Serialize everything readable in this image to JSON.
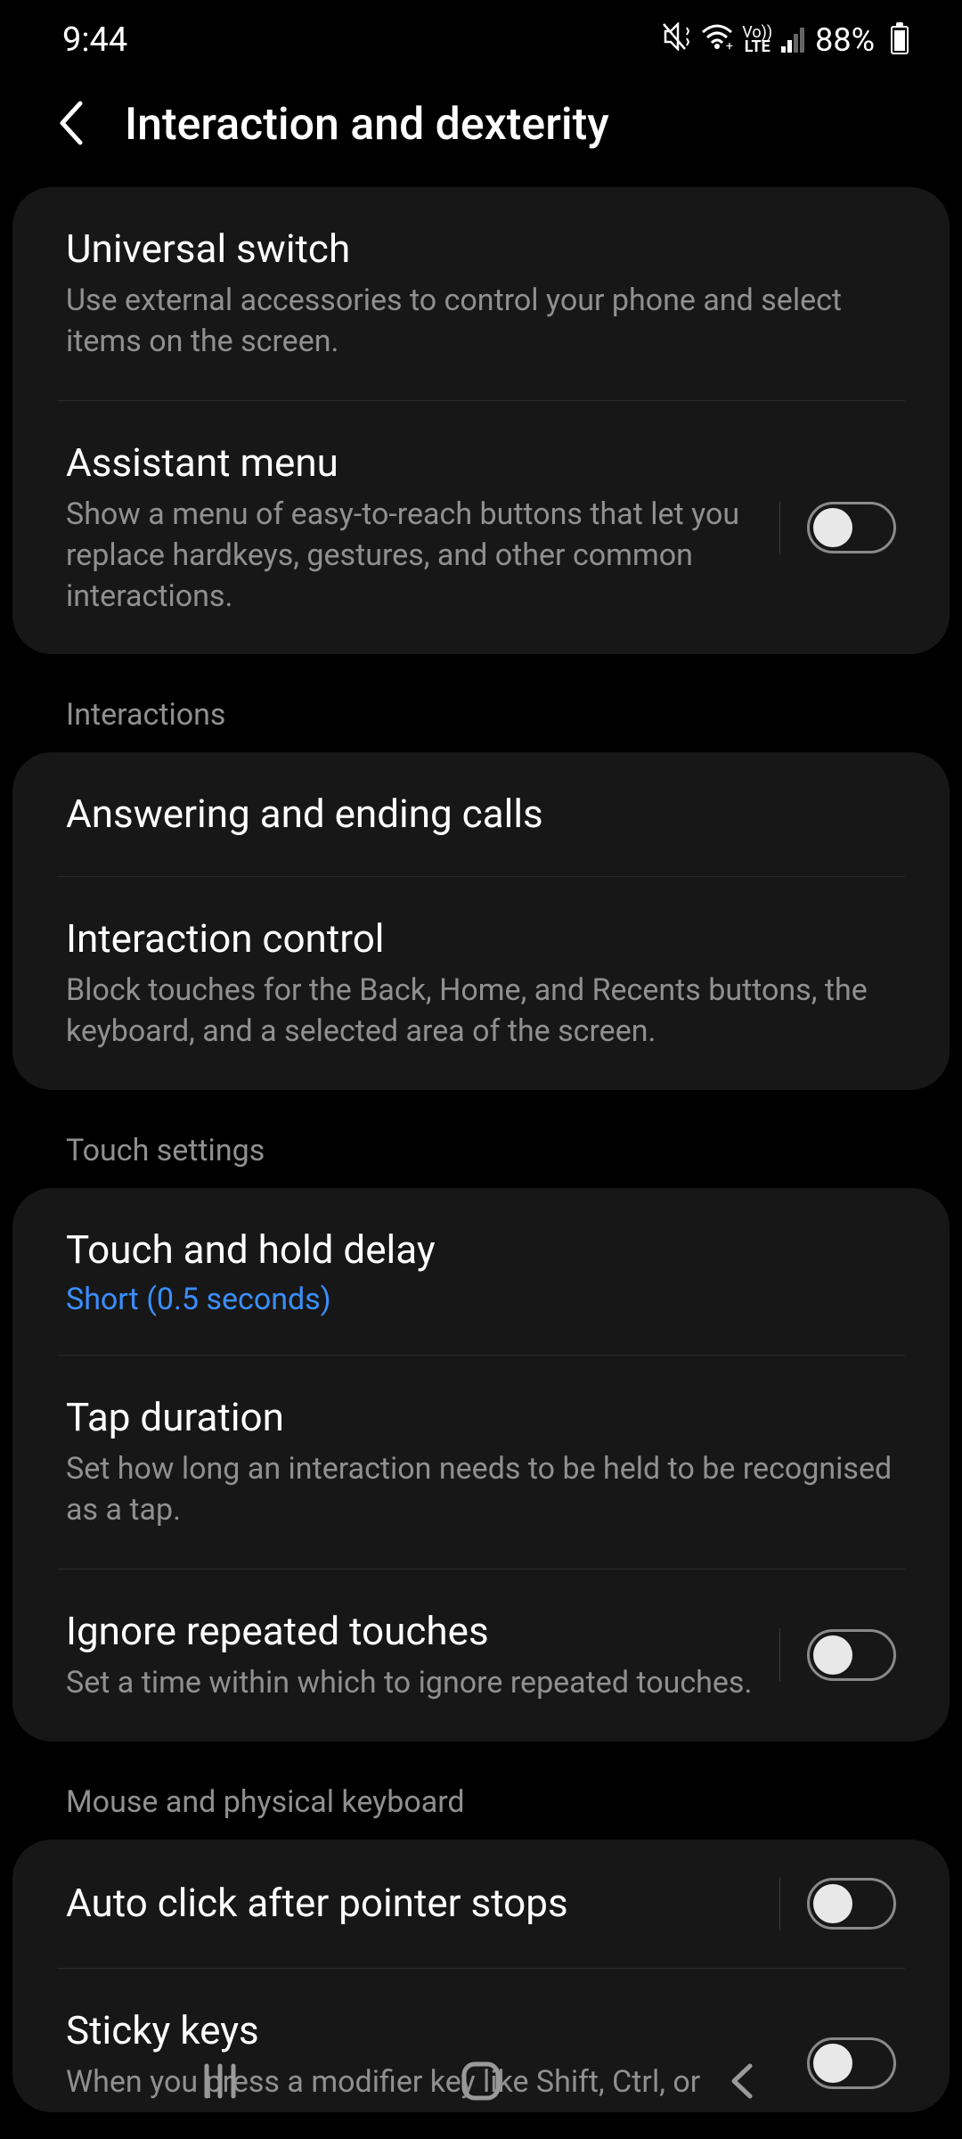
{
  "status": {
    "time": "9:44",
    "battery": "88%",
    "network": "LTE",
    "vo": "Vo))"
  },
  "header": {
    "title": "Interaction and dexterity"
  },
  "group1": {
    "universal_switch": {
      "title": "Universal switch",
      "desc": "Use external accessories to control your phone and select items on the screen."
    },
    "assistant_menu": {
      "title": "Assistant menu",
      "desc": "Show a menu of easy-to-reach buttons that let you replace hardkeys, gestures, and other common interactions."
    }
  },
  "sections": {
    "interactions": "Interactions",
    "touch_settings": "Touch settings",
    "mouse_keyboard": "Mouse and physical keyboard"
  },
  "interactions": {
    "answering_calls": {
      "title": "Answering and ending calls"
    },
    "interaction_control": {
      "title": "Interaction control",
      "desc": "Block touches for the Back, Home, and Recents buttons, the keyboard, and a selected area of the screen."
    }
  },
  "touch": {
    "touch_hold_delay": {
      "title": "Touch and hold delay",
      "value": "Short (0.5 seconds)"
    },
    "tap_duration": {
      "title": "Tap duration",
      "desc": "Set how long an interaction needs to be held to be recognised as a tap."
    },
    "ignore_repeated": {
      "title": "Ignore repeated touches",
      "desc": "Set a time within which to ignore repeated touches."
    }
  },
  "mouse": {
    "auto_click": {
      "title": "Auto click after pointer stops"
    },
    "sticky_keys": {
      "title": "Sticky keys",
      "desc": "When you press a modifier key like Shift, Ctrl, or"
    }
  }
}
